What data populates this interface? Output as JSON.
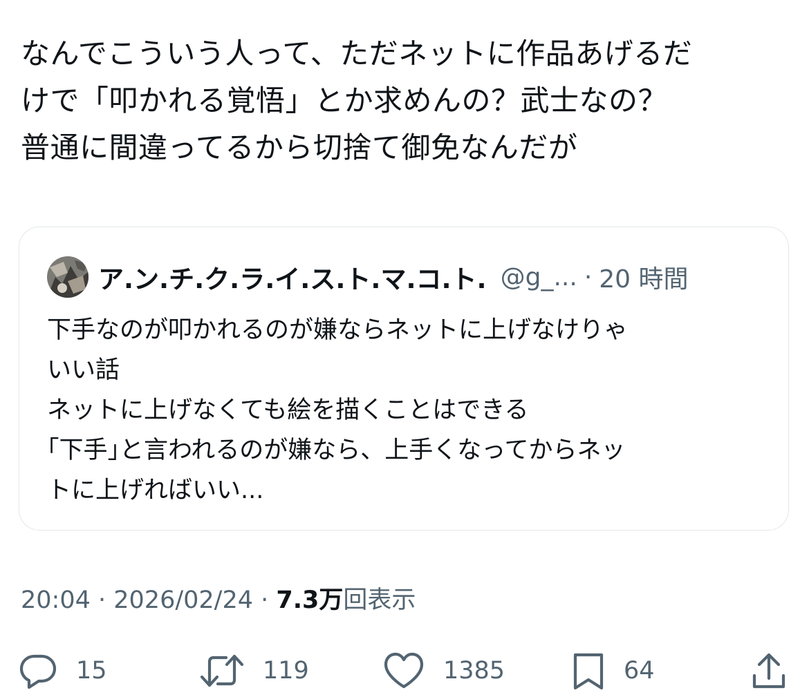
{
  "tweet": {
    "text_lines": [
      "なんでこういう人って、ただネットに作品あげるだ",
      "けで「叩かれる覚悟」とか求めんの？武士なの？",
      "普通に間違ってるから切捨て御免なんだが"
    ]
  },
  "quote": {
    "author_name": "ア.ン.チ.ク.ラ.イ.ス.ト.マ.コ.ト.",
    "handle": "@g_...",
    "separator": "·",
    "time": "20 時間",
    "text_lines": [
      "下手なのが叩かれるのが嫌ならネットに上げなけりゃ",
      "いい話",
      "ネットに上げなくても絵を描くことはできる",
      "｢下手｣と言われるのが嫌なら、上手くなってからネッ",
      "トに上げればいい..."
    ]
  },
  "meta": {
    "time": "20:04",
    "sep1": " · ",
    "date": "2026/02/24",
    "sep2": " · ",
    "views_count": "7.3万",
    "views_label": "回表示"
  },
  "actions": {
    "reply_count": "15",
    "retweet_count": "119",
    "like_count": "1385",
    "bookmark_count": "64",
    "icons": [
      "reply-icon",
      "retweet-icon",
      "heart-icon",
      "bookmark-icon",
      "share-icon"
    ]
  },
  "colors": {
    "text": "#0f1419",
    "secondary": "#536471",
    "border": "#e3e7ea"
  }
}
